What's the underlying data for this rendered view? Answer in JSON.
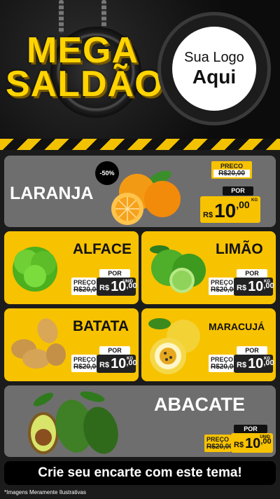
{
  "header": {
    "title_line1": "MEGA",
    "title_line2": "SALDÃO",
    "logo_line1": "Sua Logo",
    "logo_line2": "Aqui"
  },
  "feature": {
    "name": "LARANJA",
    "discount": "-50%",
    "preco_label": "PRECO",
    "old_price": "R$20,00",
    "por_label": "POR",
    "currency": "R$",
    "price_int": "10",
    "price_cents": ",00",
    "unit": "KG"
  },
  "items": [
    {
      "name": "ALFACE",
      "preco_label": "PREÇO",
      "old_price": "R$20,00",
      "por_label": "POR",
      "currency": "R$",
      "price_int": "10",
      "price_cents": ",00",
      "unit": "UNID"
    },
    {
      "name": "LIMÃO",
      "preco_label": "PREÇO",
      "old_price": "R$20,00",
      "por_label": "POR",
      "currency": "R$",
      "price_int": "10",
      "price_cents": ",00",
      "unit": "KG"
    },
    {
      "name": "BATATA",
      "preco_label": "PREÇO",
      "old_price": "R$20,00",
      "por_label": "POR",
      "currency": "R$",
      "price_int": "10",
      "price_cents": ",00",
      "unit": "KG"
    },
    {
      "name": "MARACUJÁ",
      "preco_label": "PREÇO",
      "old_price": "R$20,00",
      "por_label": "POR",
      "currency": "R$",
      "price_int": "10",
      "price_cents": ",00",
      "unit": "KG"
    },
    {
      "name": "ABACATE",
      "preco_label": "PREÇO",
      "old_price": "R$20,00",
      "por_label": "POR",
      "currency": "R$",
      "price_int": "10",
      "price_cents": ",00",
      "unit": "UNID"
    }
  ],
  "footer": {
    "cta": "Crie seu encarte com este tema!",
    "note": "*Imagens Meramente Ilustrativas"
  },
  "colors": {
    "accent": "#f7c200",
    "dark": "#111111",
    "panel": "#6e6e6e"
  }
}
